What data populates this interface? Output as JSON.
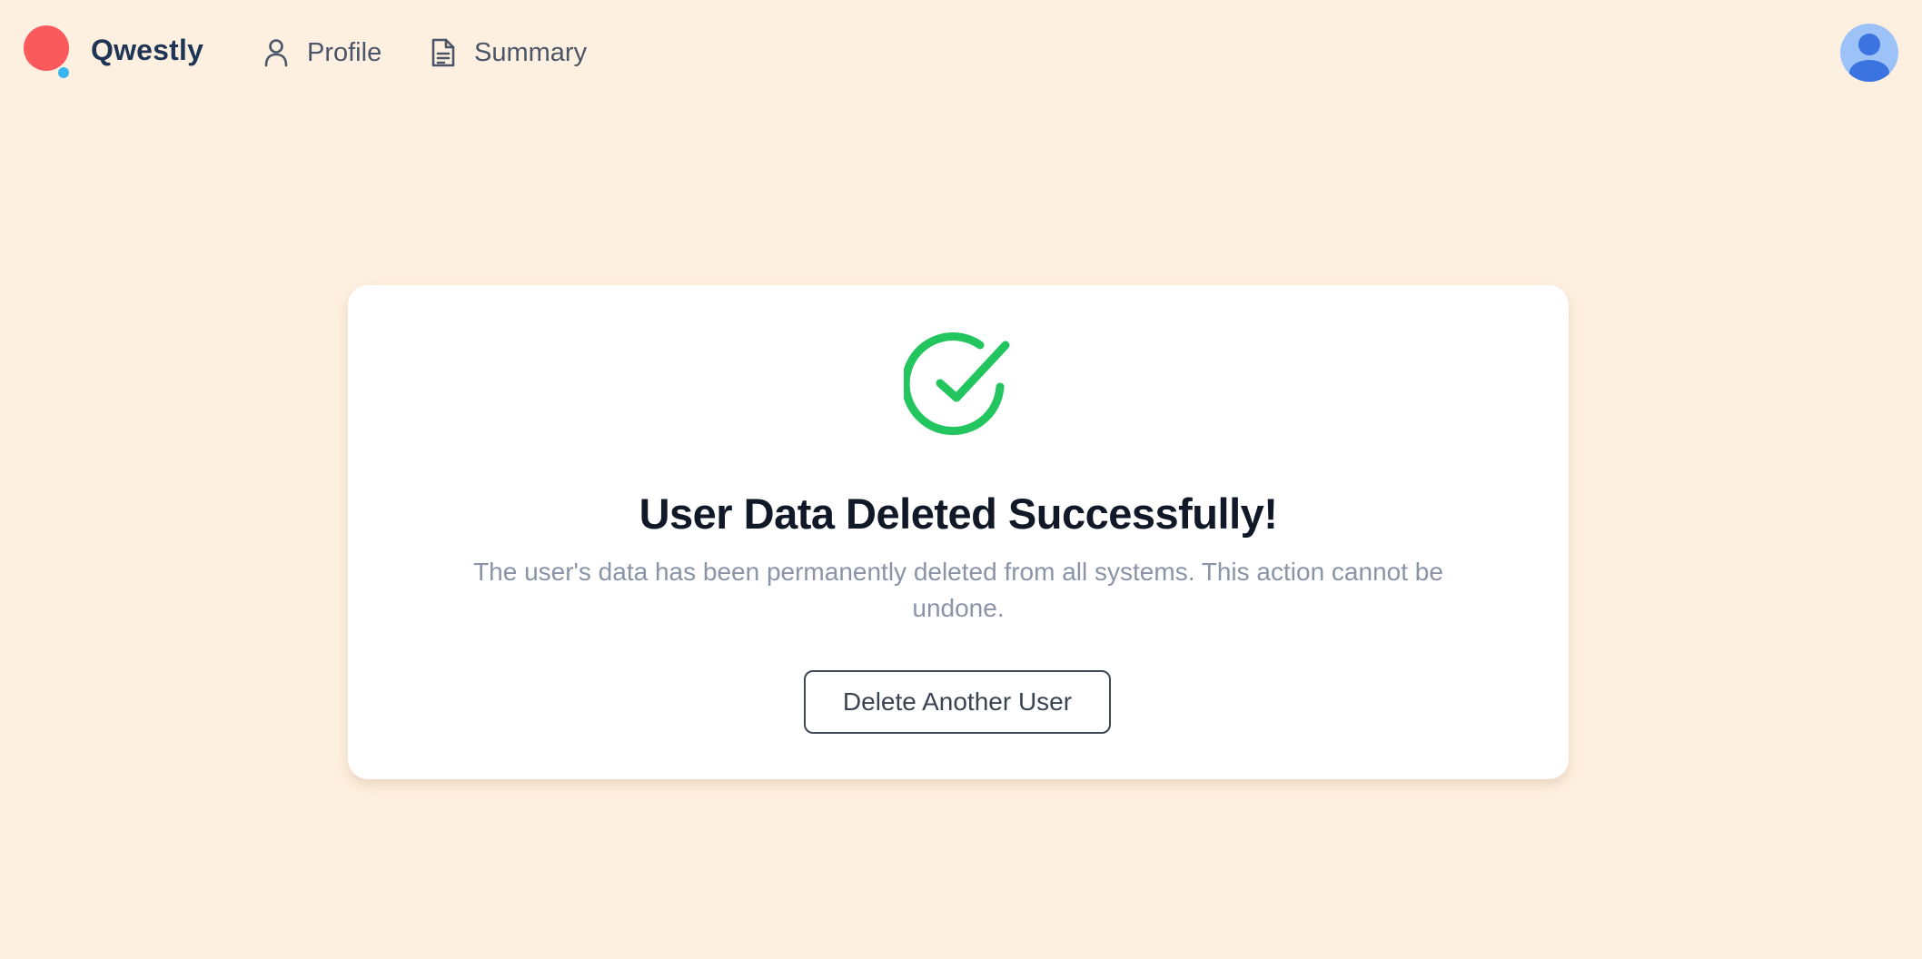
{
  "header": {
    "brand": "Qwestly",
    "nav": [
      {
        "label": "Profile",
        "icon": "user-icon"
      },
      {
        "label": "Summary",
        "icon": "document-icon"
      }
    ],
    "avatar_icon": "user-avatar-icon"
  },
  "card": {
    "icon": "check-circle-icon",
    "title": "User Data Deleted Successfully!",
    "message": "The user's data has been permanently deleted from all systems. This action cannot be undone.",
    "button_label": "Delete Another User"
  },
  "colors": {
    "background": "#fef0e0",
    "brand_red": "#fb5a5c",
    "brand_blue": "#3ab5f0",
    "success_green": "#22c55e",
    "avatar_bg": "#9dc2f8",
    "avatar_fg": "#3b74e0"
  }
}
